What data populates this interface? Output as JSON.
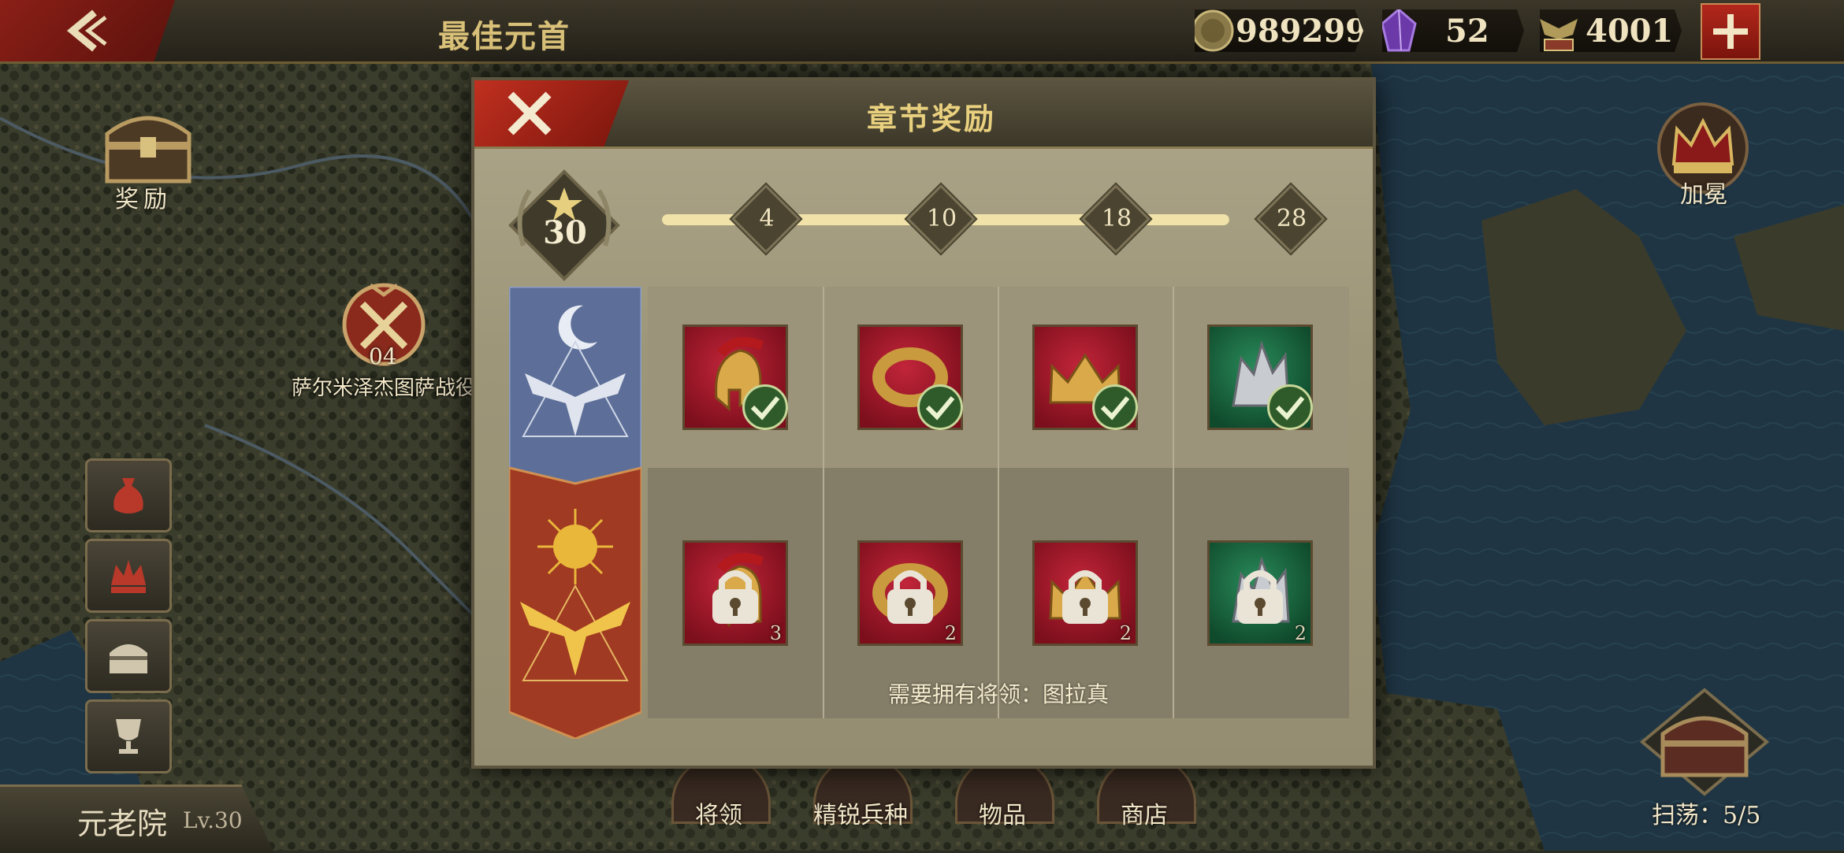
{
  "header": {
    "title": "最佳元首",
    "resources": [
      {
        "icon": "coin-icon",
        "value": "989299"
      },
      {
        "icon": "purple-gem-icon",
        "value": "52"
      },
      {
        "icon": "spqr-eagle-icon",
        "value": "4001"
      }
    ]
  },
  "left_panel": {
    "reward_label": "奖励",
    "battle": {
      "number": "04",
      "name": "萨尔米泽杰图萨战役"
    },
    "senate": {
      "name": "元老院",
      "level": "Lv.30"
    }
  },
  "right_panel": {
    "coronation_label": "加冕",
    "sweep_label": "扫荡：5/5"
  },
  "bottom_nav": [
    "将领",
    "精锐兵种",
    "物品",
    "商店"
  ],
  "modal": {
    "title": "章节奖励",
    "stars": "30",
    "progress": 1.0,
    "milestones": [
      "4",
      "10",
      "18",
      "28"
    ],
    "free_rewards": [
      {
        "icon": "spartan-helmet-icon",
        "claimed": true
      },
      {
        "icon": "gold-ring-icon",
        "claimed": true
      },
      {
        "icon": "crown-icon",
        "claimed": true
      },
      {
        "icon": "silver-ore-icon",
        "claimed": true
      }
    ],
    "premium_rewards": [
      {
        "icon": "spartan-helmet-icon",
        "quantity": "3",
        "locked": true
      },
      {
        "icon": "gold-ring-icon",
        "quantity": "2",
        "locked": true
      },
      {
        "icon": "crown-icon",
        "quantity": "2",
        "locked": true
      },
      {
        "icon": "silver-ore-icon",
        "quantity": "2",
        "locked": true
      }
    ],
    "requirement_text": "需要拥有将领：图拉真"
  },
  "colors": {
    "accent_red": "#b3271b",
    "gold_text": "#e8d07e",
    "panel_bg": "#a39c80"
  }
}
